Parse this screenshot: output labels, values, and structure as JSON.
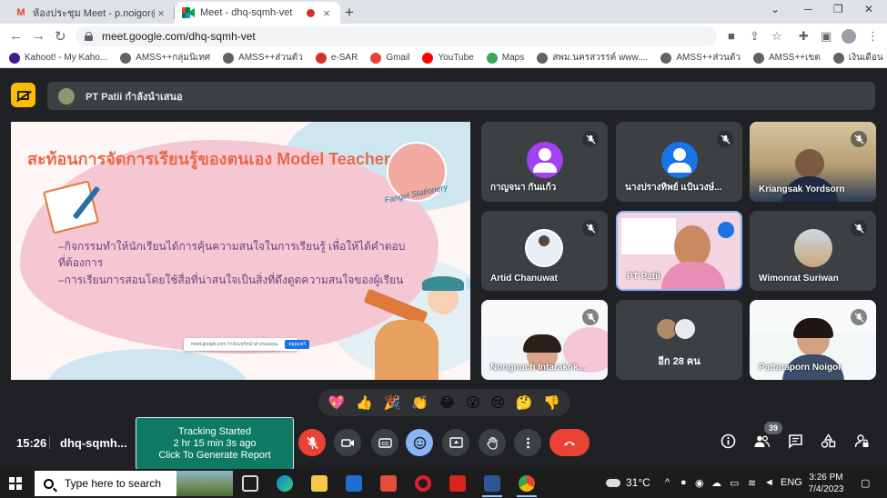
{
  "browser": {
    "tabs": [
      {
        "title": "ห้องประชุม Meet - p.noigor@gmai",
        "icon": "gmail-icon"
      },
      {
        "title": "Meet - dhq-sqmh-vet",
        "icon": "meet-icon"
      }
    ],
    "url": "meet.google.com/dhq-sqmh-vet",
    "bookmarks": [
      {
        "label": "Kahoot! - My Kaho...",
        "icon": "kahoot-icon",
        "color": "#46178f"
      },
      {
        "label": "AMSS++กลุ่มนิเทศ",
        "icon": "globe-icon",
        "color": "#5f6368"
      },
      {
        "label": "AMSS++ส่วนตัว",
        "icon": "globe-icon",
        "color": "#5f6368"
      },
      {
        "label": "e-SAR",
        "icon": "esar-icon",
        "color": "#d93025"
      },
      {
        "label": "Gmail",
        "icon": "gmail-icon",
        "color": "#ea4335"
      },
      {
        "label": "YouTube",
        "icon": "youtube-icon",
        "color": "#ff0000"
      },
      {
        "label": "Maps",
        "icon": "maps-icon",
        "color": "#34a853"
      },
      {
        "label": "สพม.นครสวรรค์ www....",
        "icon": "globe-icon",
        "color": "#5f6368"
      },
      {
        "label": "AMSS++ส่วนตัว",
        "icon": "globe-icon",
        "color": "#5f6368"
      },
      {
        "label": "AMSS++เขต",
        "icon": "globe-icon",
        "color": "#5f6368"
      },
      {
        "label": "เงินเดือน",
        "icon": "globe-icon",
        "color": "#5f6368"
      }
    ]
  },
  "meet": {
    "presenter_banner": "PT Patii กำลังนำเสนอ",
    "slide": {
      "title": "สะท้อนการจัดการเรียนรู้ของตนเอง Model Teacher",
      "logo_text": "Fangel Stationery",
      "bullets": [
        "–กิจกรรมทำให้นักเรียนได้การคุ้นความสนใจในการเรียนรู้ เพื่อให้ได้คำตอบ",
        "ที่ต้องการ",
        "–การเรียนการสอนโดยใช้สื่อที่น่าสนใจเป็นสิ่งที่ดึงดูดความสนใจของผู้เรียน"
      ],
      "share_chip": "meet.google.com กำลังแชร์หน้าต่างของคุณ",
      "share_chip_button": "หยุดแชร์"
    },
    "participants": [
      {
        "name": "กาญจนา กันแก้ว",
        "avatar_color": "#a142f4"
      },
      {
        "name": "นางปรางทิพย์ แป้นวงษ์...",
        "avatar_color": "#1a73e8"
      },
      {
        "name": "Kriangsak Yordsorn"
      },
      {
        "name": "Artid Chanuwat"
      },
      {
        "name": "PT Patii"
      },
      {
        "name": "Wimonrat Suriwan"
      },
      {
        "name": "Nongnuch Intarakok..."
      },
      {
        "name": "อีก 28 คน"
      },
      {
        "name": "Pattaraporn Noigor"
      }
    ],
    "reactions": [
      "💖",
      "👍",
      "🎉",
      "👏",
      "😂",
      "😮",
      "😢",
      "🤔",
      "👎"
    ],
    "tracker": {
      "line1": "Tracking Started",
      "line2": "2 hr 15 min 3s ago",
      "line3": "Click To Generate Report"
    },
    "time": "15:26",
    "meeting_code": "dhq-sqmh...",
    "participant_count": "39"
  },
  "taskbar": {
    "search_placeholder": "Type here to search",
    "temperature": "31°C",
    "language": "ENG",
    "time": "3:26 PM",
    "date": "7/4/2023"
  }
}
